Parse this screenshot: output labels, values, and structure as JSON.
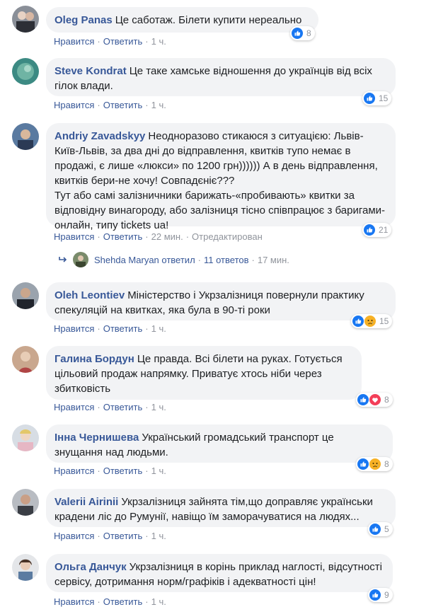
{
  "actions": {
    "like": "Нравится",
    "reply": "Ответить"
  },
  "comments": [
    {
      "author": "Oleg Panas",
      "text": "Це саботаж. Білети купити нереально",
      "time": "1 ч.",
      "edited": "",
      "reactions": [
        "like"
      ],
      "count": "8"
    },
    {
      "author": "Steve Kondrat",
      "text": "Це таке хамське відношення до українців від всіх гілок влади.",
      "time": "1 ч.",
      "edited": "",
      "reactions": [
        "like"
      ],
      "count": "15"
    },
    {
      "author": "Andriy Zavadskyy",
      "text": "Неодноразово стикаюся з ситуацією: Львів-Київ-Львів, за два дні до відправлення, квитків тупо немає в продажі, є лише «люкси» по 1200 грн)))))) А в день відправлення, квитків бери-не хочу! Совпадєніє???\nТут або самі залізничники барижать-«пробивають» квитки за відповідну винагороду, або залізниця тісно співпрацює з баригами-онлайн, типу tickets ua!",
      "time": "22 мин.",
      "edited": "Отредактирован",
      "reactions": [
        "like"
      ],
      "count": "21"
    },
    {
      "author": "Oleh Leontiev",
      "text": "Міністерство і Укрзалізниця повернули практику спекуляцій на квитках, яка була в 90-ті роки",
      "time": "1 ч.",
      "edited": "",
      "reactions": [
        "like",
        "sad"
      ],
      "count": "15"
    },
    {
      "author": "Галина Бордун",
      "text": "Це правда. Всі білети на руках. Готується цільовий продаж напрямку. Приватує хтось ніби через збитковість",
      "time": "1 ч.",
      "edited": "",
      "reactions": [
        "like",
        "love"
      ],
      "count": "8"
    },
    {
      "author": "Інна Чернишева",
      "text": "Український громадський транспорт це знущання над людьми.",
      "time": "1 ч.",
      "edited": "",
      "reactions": [
        "like",
        "sad"
      ],
      "count": "8"
    },
    {
      "author": "Valerii Airinii",
      "text": "Укрзалізниця зайнята тім,що доправляє українськи крадени ліс до Румунії, навіщо їм заморачуватися на людях...",
      "time": "1 ч.",
      "edited": "",
      "reactions": [
        "like"
      ],
      "count": "5"
    },
    {
      "author": "Ольга Данчук",
      "text": "Укрзалізниця в корінь приклад наглості, відсутності сервісу, дотримання норм/графіків і адекватності цін!",
      "time": "1 ч.",
      "edited": "",
      "reactions": [
        "like"
      ],
      "count": "9"
    }
  ],
  "reply_summary": {
    "replier": "Shehda Maryan ответил",
    "replies": "11 ответов",
    "time": "17 мин."
  },
  "colors": {
    "link": "#385898",
    "bubble": "#f2f3f5",
    "like": "#1877f2",
    "love": "#f33e58",
    "sad": "#f7b125"
  }
}
